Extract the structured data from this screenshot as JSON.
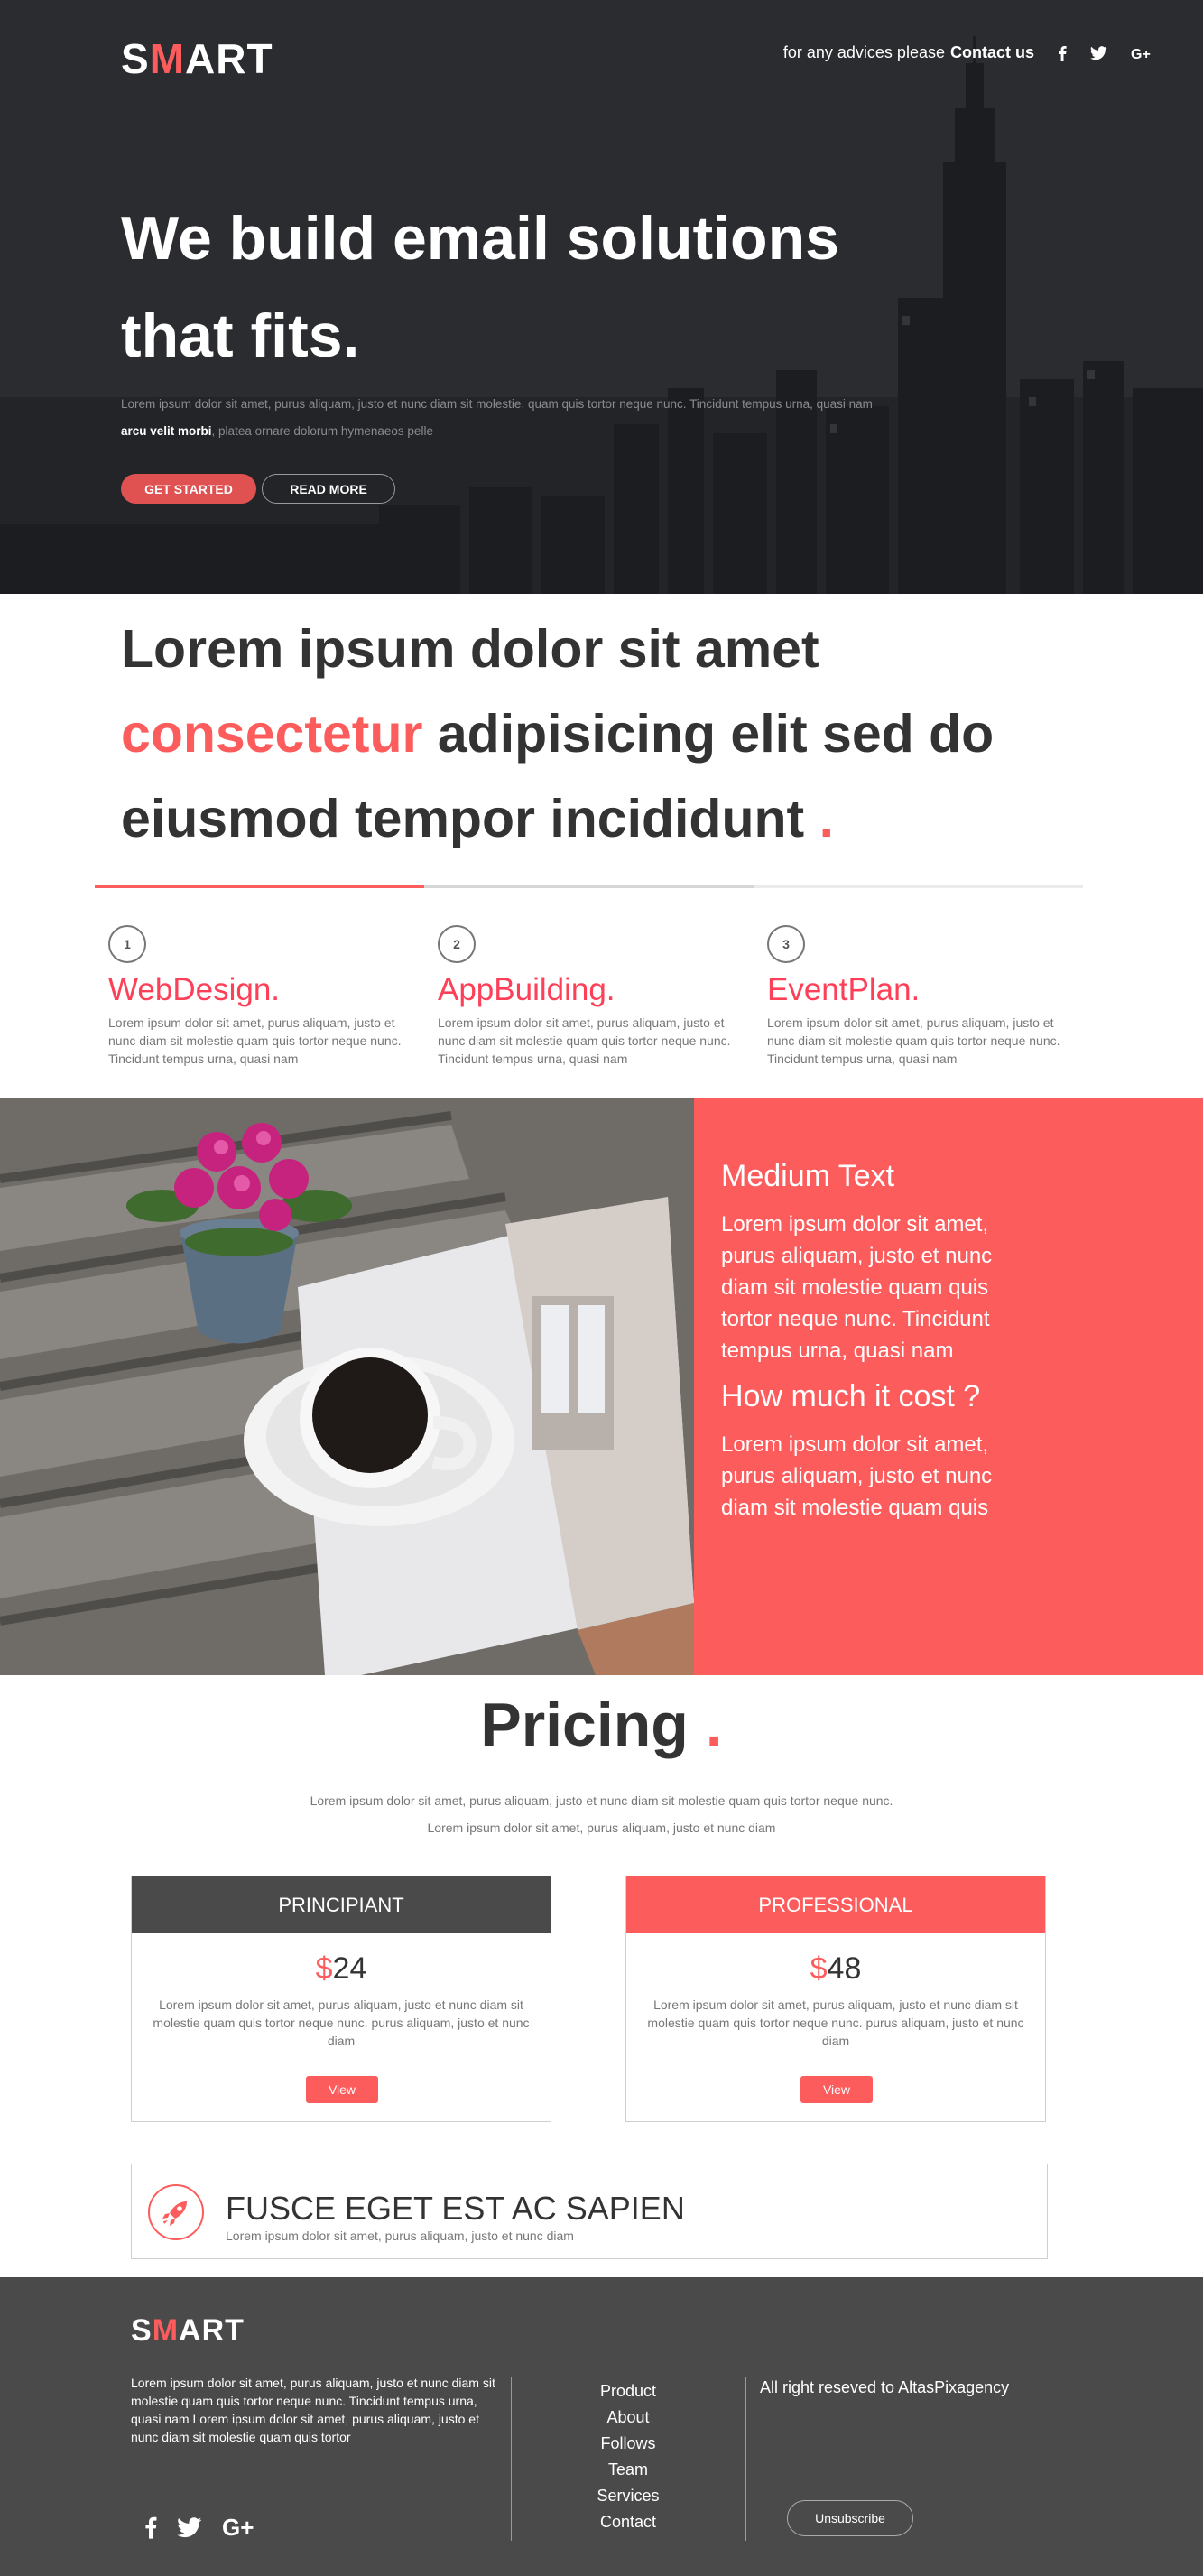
{
  "brand": {
    "logo_first": "S",
    "logo_accent": "M",
    "logo_rest": "ART",
    "accent_color": "#fd5c5c"
  },
  "top_nav": {
    "advice_text": "for any advices please",
    "contact_label": "Contact us",
    "social_icons": [
      "facebook-icon",
      "twitter-icon",
      "google-plus-icon"
    ]
  },
  "hero": {
    "title_line1": "We build email solutions",
    "title_line2": "that fits.",
    "desc_part1": "Lorem ipsum dolor sit amet, purus aliquam, justo et nunc diam sit molestie, quam quis tortor neque nunc. Tincidunt tempus urna, quasi nam",
    "desc_bold": "arcu velit morbi",
    "desc_part2": ", platea ornare dolorum hymenaeos pelle",
    "btn_start": "GET STARTED",
    "btn_more": "READ MORE"
  },
  "intro": {
    "line1": "Lorem ipsum dolor sit amet",
    "highlight": "consectetur",
    "line2_rest": " adipisicing elit sed do",
    "line3": "eiusmod tempor incididunt",
    "dot": " ."
  },
  "steps": [
    {
      "num": "1",
      "title": "WebDesign.",
      "text": "Lorem ipsum dolor sit amet, purus aliquam, justo et nunc diam sit molestie quam quis tortor neque nunc. Tincidunt tempus urna, quasi nam"
    },
    {
      "num": "2",
      "title": "AppBuilding.",
      "text": "Lorem ipsum dolor sit amet, purus aliquam, justo et nunc diam sit molestie quam quis tortor neque nunc. Tincidunt tempus urna, quasi nam"
    },
    {
      "num": "3",
      "title": "EventPlan.",
      "text": "Lorem ipsum dolor sit amet, purus aliquam, justo et nunc diam sit molestie quam quis tortor neque nunc. Tincidunt tempus urna, quasi nam"
    }
  ],
  "feature": {
    "heading1": "Medium Text",
    "para1": "Lorem ipsum dolor sit amet, purus aliquam, justo et nunc diam sit molestie quam quis tortor neque nunc. Tincidunt tempus urna, quasi nam",
    "heading2": "How much it cost ?",
    "para2": "Lorem ipsum dolor sit amet, purus aliquam, justo et nunc diam sit molestie quam quis"
  },
  "pricing": {
    "title": "Pricing",
    "dot": " .",
    "sub_line1": "Lorem ipsum dolor sit amet, purus aliquam, justo et nunc diam sit molestie quam quis tortor neque nunc.",
    "sub_line2": "Lorem ipsum dolor sit amet, purus aliquam, justo et nunc diam",
    "plans": [
      {
        "name": "PRINCIPIANT",
        "currency": "$",
        "amount": "24",
        "desc": "Lorem ipsum dolor sit amet, purus aliquam, justo et nunc diam sit molestie quam quis tortor neque nunc. purus aliquam, justo et nunc diam",
        "button": "View",
        "header_color": "#4a4a4a"
      },
      {
        "name": "PROFESSIONAL",
        "currency": "$",
        "amount": "48",
        "desc": "Lorem ipsum dolor sit amet, purus aliquam, justo et nunc diam sit molestie quam quis tortor neque nunc. purus aliquam, justo et nunc diam",
        "button": "View",
        "header_color": "#fd5c5c"
      }
    ]
  },
  "fusce": {
    "title": "FUSCE EGET EST AC SAPIEN",
    "subtitle": "Lorem ipsum dolor sit amet, purus aliquam, justo et nunc diam",
    "icon": "rocket-icon"
  },
  "footer": {
    "about": "Lorem ipsum dolor sit amet, purus aliquam, justo et nunc diam sit molestie quam quis tortor neque nunc. Tincidunt tempus urna, quasi nam Lorem ipsum dolor sit amet, purus aliquam, justo et nunc diam sit molestie quam quis tortor",
    "links": [
      "Product",
      "About",
      "Follows",
      "Team",
      "Services",
      "Contact"
    ],
    "rights": "All right reseved to AltasPixagency",
    "unsubscribe": "Unsubscribe",
    "social_icons": [
      "facebook-icon",
      "twitter-icon",
      "google-plus-icon"
    ],
    "bg_color": "#4a4a4a"
  }
}
